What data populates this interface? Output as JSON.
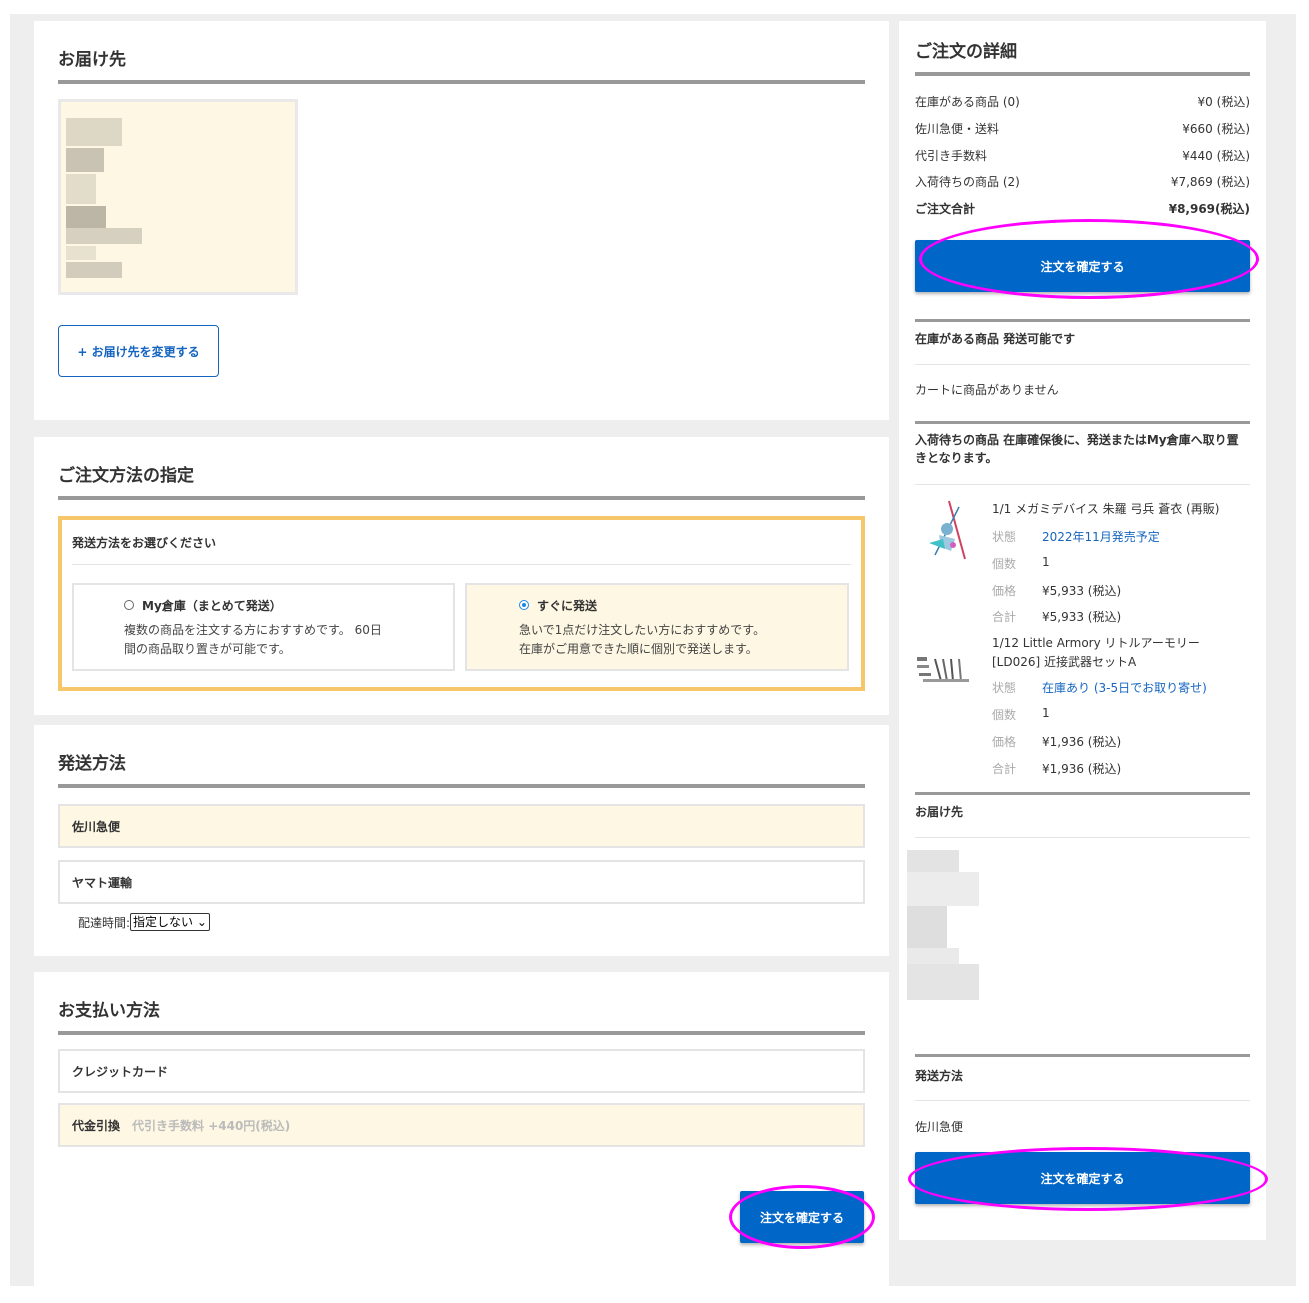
{
  "delivery": {
    "title": "お届け先",
    "change_button": "+ お届け先を変更する"
  },
  "order_method": {
    "title": "ご注文方法の指定",
    "prompt": "発送方法をお選びください",
    "options": [
      {
        "label": "My倉庫（まとめて発送）",
        "desc1": "複数の商品を注文する方におすすめです。 60日",
        "desc2": "間の商品取り置きが可能です。",
        "selected": false
      },
      {
        "label": "すぐに発送",
        "desc1": "急いで1点だけ注文したい方におすすめです。",
        "desc2": "在庫がご用意できた順に個別で発送します。",
        "selected": true
      }
    ]
  },
  "shipping": {
    "title": "発送方法",
    "carriers": [
      {
        "label": "佐川急便",
        "selected": true
      },
      {
        "label": "ヤマト運輸",
        "selected": false
      }
    ],
    "time_label": "配達時間:",
    "time_value": "指定しない"
  },
  "payment": {
    "title": "お支払い方法",
    "methods": [
      {
        "label": "クレジットカード",
        "note": "",
        "selected": false
      },
      {
        "label": "代金引換",
        "note": "代引き手数料 +440円(税込)",
        "selected": true
      }
    ],
    "confirm_button": "注文を確定する"
  },
  "summary": {
    "title": "ご注文の詳細",
    "rows": [
      {
        "label": "在庫がある商品 (0)",
        "value": "¥0 (税込)"
      },
      {
        "label": "佐川急便・送料",
        "value": "¥660 (税込)"
      },
      {
        "label": "代引き手数料",
        "value": "¥440 (税込)"
      },
      {
        "label": "入荷待ちの商品 (2)",
        "value": "¥7,869 (税込)"
      },
      {
        "label": "ご注文合計",
        "value": "¥8,969(税込)"
      }
    ],
    "confirm_button": "注文を確定する",
    "in_stock_heading": "在庫がある商品 発送可能です",
    "cart_empty": "カートに商品がありません",
    "backorder_heading": "入荷待ちの商品 在庫確保後に、発送またはMy倉庫へ取り置きとなります。",
    "items": [
      {
        "name": "1/1 メガミデバイス 朱羅 弓兵 蒼衣 (再販)",
        "status_k": "状態",
        "status": "2022年11月発売予定",
        "qty_k": "個数",
        "qty": "1",
        "price_k": "価格",
        "price": "¥5,933 (税込)",
        "total_k": "合計",
        "total": "¥5,933 (税込)"
      },
      {
        "name": "1/12 Little Armory リトルアーモリー [LD026] 近接武器セットA",
        "status_k": "状態",
        "status": "在庫あり (3-5日でお取り寄せ)",
        "qty_k": "個数",
        "qty": "1",
        "price_k": "価格",
        "price": "¥1,936 (税込)",
        "total_k": "合計",
        "total": "¥1,936 (税込)"
      }
    ],
    "delivery_heading": "お届け先",
    "shipping_heading": "発送方法",
    "shipping_value": "佐川急便",
    "confirm_button_2": "注文を確定する"
  },
  "colors": {
    "accent": "#0066c8",
    "highlight": "#ff00ff",
    "selected_bg": "#fdf7e3",
    "border_orange": "#f6c66a"
  }
}
